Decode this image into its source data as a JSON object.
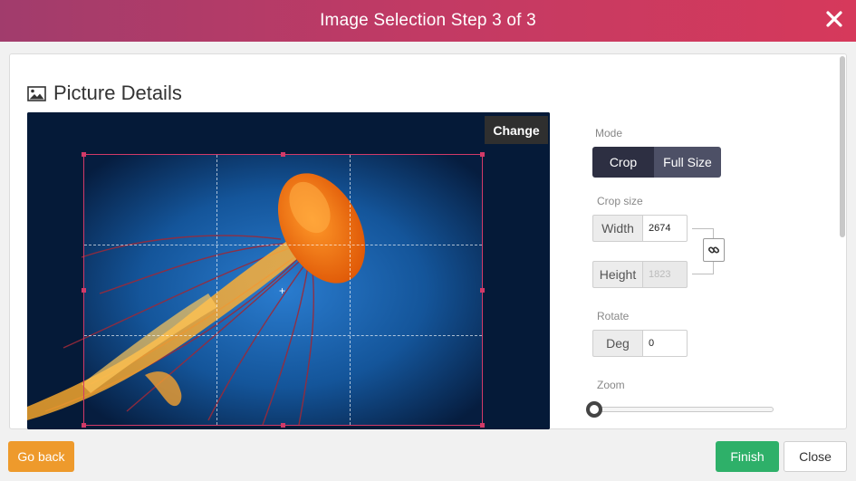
{
  "header": {
    "title": "Image Selection Step 3 of 3",
    "close_icon": "close-icon"
  },
  "section": {
    "title": "Picture Details",
    "icon": "image-icon"
  },
  "image": {
    "change_label": "Change",
    "subject_icon": "jellyfish-photo"
  },
  "mode": {
    "label": "Mode",
    "crop_label": "Crop",
    "fullsize_label": "Full Size",
    "selected": "Crop"
  },
  "crop_size": {
    "label": "Crop size",
    "width_label": "Width",
    "width_value": "2674",
    "height_label": "Height",
    "height_value": "1823",
    "link_icon": "link-icon"
  },
  "rotate": {
    "label": "Rotate",
    "deg_label": "Deg",
    "deg_value": "0"
  },
  "zoom": {
    "label": "Zoom",
    "value": 0
  },
  "footer": {
    "back_label": "Go back",
    "finish_label": "Finish",
    "close_label": "Close"
  },
  "colors": {
    "header_start": "#a13c6c",
    "header_end": "#d6395b",
    "crop_border": "#d23a68",
    "finish": "#2eb069",
    "back": "#ee9a2c"
  }
}
